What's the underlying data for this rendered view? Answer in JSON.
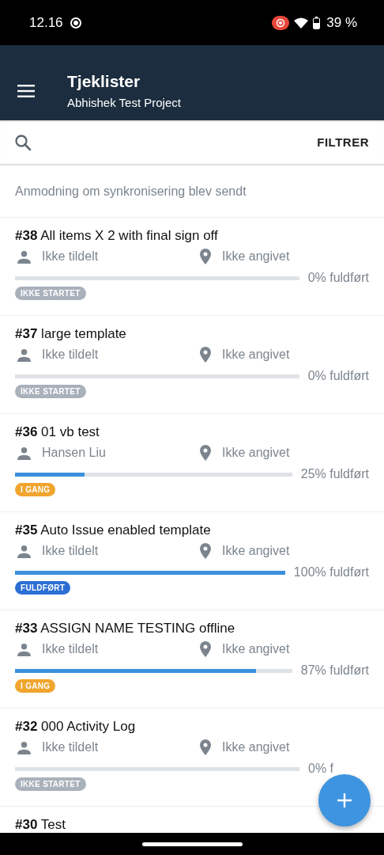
{
  "status_bar": {
    "time": "12.16",
    "battery": "39 %"
  },
  "header": {
    "title": "Tjeklister",
    "subtitle": "Abhishek Test Project"
  },
  "search": {
    "filter_label": "FILTRER"
  },
  "sync_message": "Anmodning om synkronisering blev sendt",
  "checklists": [
    {
      "title": "**#38** All items X 2 with final sign off",
      "assignee": "Ikke tildelt",
      "location": "Ikke angivet",
      "level": 0,
      "progress": "0% fuldført",
      "status": {
        "label": "IKKE STARTET",
        "kind": "not_started"
      }
    },
    {
      "title": "**#37** large template",
      "assignee": "Ikke tildelt",
      "location": "Ikke angivet",
      "level": 0,
      "progress": "0% fuldført",
      "status": {
        "label": "IKKE STARTET",
        "kind": "not_started"
      }
    },
    {
      "title": "**#36** 01 vb test",
      "assignee": "Hansen Liu",
      "location": "Ikke angivet",
      "level": 0.25,
      "progress": "25% fuldført",
      "status": {
        "label": "I GANG",
        "kind": "in_progress"
      }
    },
    {
      "title": "**#35** Auto Issue enabled template",
      "assignee": "Ikke tildelt",
      "location": "Ikke angivet",
      "level": 1,
      "progress": "100% fuldført",
      "status": {
        "label": "FULDFØRT",
        "kind": "done"
      }
    },
    {
      "title": "**#33** ASSIGN NAME TESTING offline",
      "assignee": "Ikke tildelt",
      "location": "Ikke angivet",
      "level": 0.87,
      "progress": "87% fuldført",
      "status": {
        "label": "I GANG",
        "kind": "in_progress"
      }
    },
    {
      "title": "**#32** 000 Activity Log",
      "assignee": "Ikke tildelt",
      "location": "Ikke angivet",
      "level": 0,
      "progress": "0% f",
      "status": {
        "label": "IKKE STARTET",
        "kind": "not_started"
      }
    },
    {
      "title": "**#30** Test"
    }
  ]
}
